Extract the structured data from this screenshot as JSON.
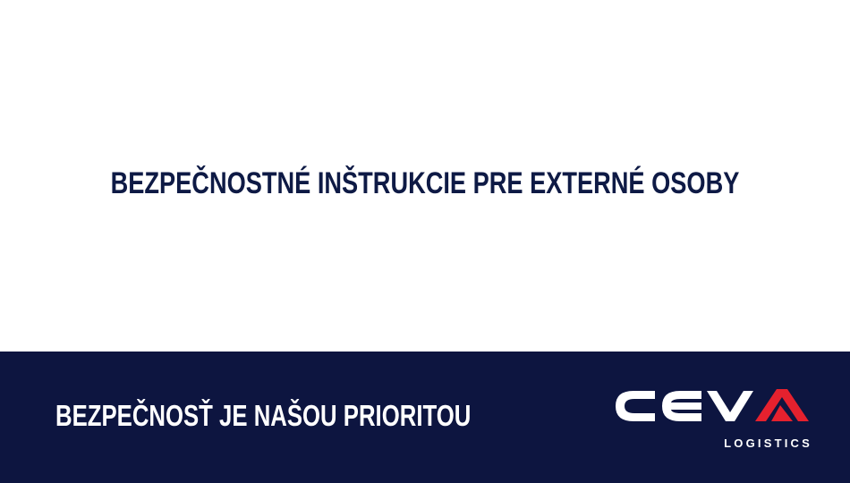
{
  "slide": {
    "title": "BEZPEČNOSTNÉ INŠTRUKCIE PRE EXTERNÉ OSOBY",
    "footer_slogan": "BEZPEČNOSŤ JE NAŠOU PRIORITOU"
  },
  "logo": {
    "brand": "CEVA",
    "tagline": "LOGISTICS"
  },
  "colors": {
    "navy": "#0d1540",
    "title_text": "#0e1a45",
    "accent_red": "#e5212e",
    "white": "#ffffff"
  }
}
